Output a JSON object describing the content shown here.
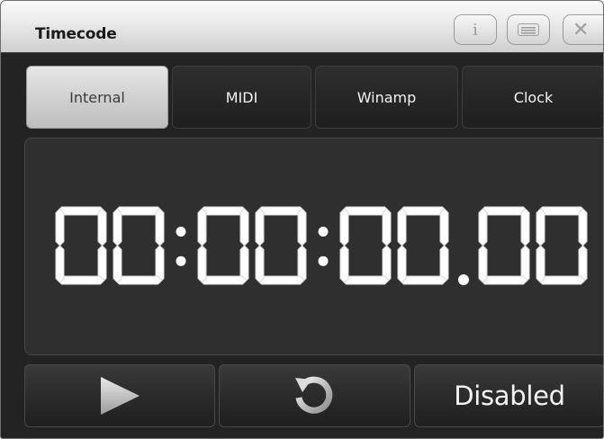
{
  "window": {
    "title": "Timecode",
    "title_buttons": [
      {
        "name": "info-icon",
        "glyph": "i"
      },
      {
        "name": "menu-icon",
        "glyph": ""
      },
      {
        "name": "close-icon",
        "glyph": "✕"
      }
    ]
  },
  "tabs": [
    {
      "label": "Internal",
      "active": true
    },
    {
      "label": "MIDI",
      "active": false
    },
    {
      "label": "Winamp",
      "active": false
    },
    {
      "label": "Clock",
      "active": false
    }
  ],
  "display": {
    "timecode": "00:00:00.00"
  },
  "controls": {
    "play_icon": "play-icon",
    "reset_icon": "reset-icon",
    "mode_label": "Disabled"
  },
  "colors": {
    "window_bg": "#232323",
    "active_tab": "#cfcfcf",
    "segment": "#ffffff"
  }
}
